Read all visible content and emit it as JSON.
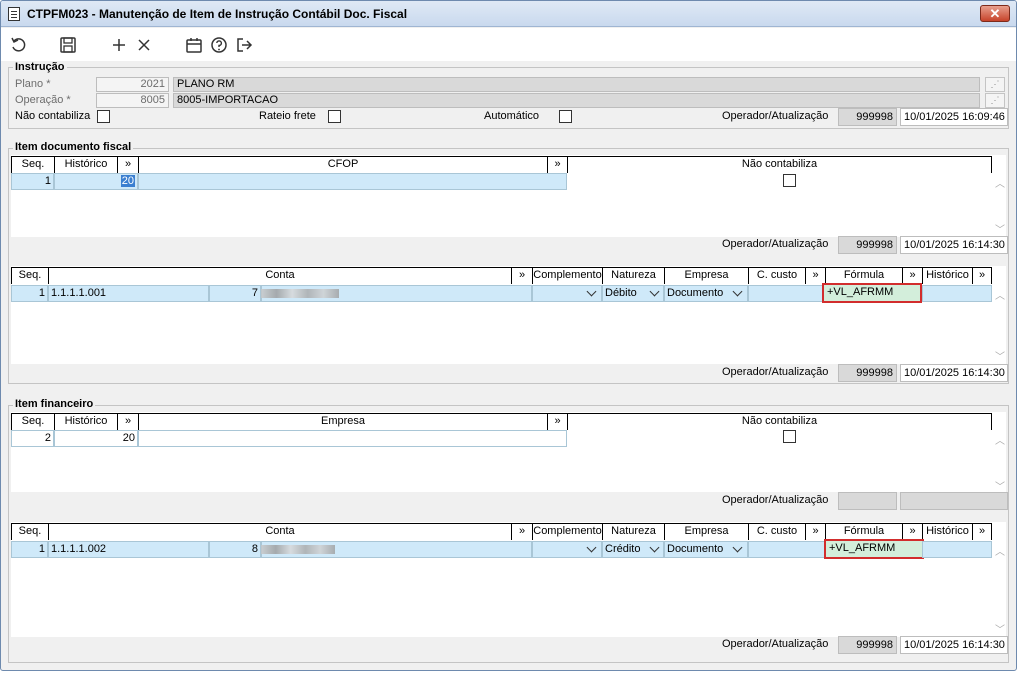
{
  "window": {
    "title": "CTPFM023 - Manutenção de Item de Instrução Contábil Doc. Fiscal",
    "close_label": "✕"
  },
  "toolbar": {
    "icons": [
      "undo-icon",
      "save-icon",
      "add-icon",
      "delete-icon",
      "calendar-icon",
      "help-icon",
      "exit-icon"
    ]
  },
  "instrucao": {
    "title": "Instrução",
    "plano_label": "Plano *",
    "plano_code": "2021",
    "plano_name": "PLANO RM",
    "operacao_label": "Operação *",
    "operacao_code": "8005",
    "operacao_name": "8005-IMPORTACAO",
    "nao_contabiliza_label": "Não contabiliza",
    "rateio_label": "Rateio frete",
    "automatico_label": "Automático",
    "oper_label": "Operador/Atualização",
    "operador": "999998",
    "atualizacao": "10/01/2025 16:09:46"
  },
  "item_doc": {
    "title": "Item documento fiscal",
    "headers": {
      "seq": "Seq.",
      "historico": "Histórico",
      "more": "»",
      "cfop": "CFOP",
      "nao_contabiliza": "Não contabiliza"
    },
    "row": {
      "seq": "1",
      "historico": "20"
    },
    "oper_label": "Operador/Atualização",
    "operador": "999998",
    "atualizacao": "10/01/2025 16:14:30"
  },
  "conta_grid_1": {
    "headers": {
      "seq": "Seq.",
      "conta": "Conta",
      "more": "»",
      "complemento": "Complemento",
      "natureza": "Natureza",
      "empresa": "Empresa",
      "ccusto": "C. custo",
      "formula": "Fórmula",
      "historico": "Histórico"
    },
    "row": {
      "seq": "1",
      "conta": "1.1.1.1.001",
      "conta_num": "7",
      "natureza": "Débito",
      "empresa": "Documento",
      "formula": "+VL_AFRMM"
    },
    "oper_label": "Operador/Atualização",
    "operador": "999998",
    "atualizacao": "10/01/2025 16:14:30"
  },
  "item_fin": {
    "title": "Item financeiro",
    "headers": {
      "seq": "Seq.",
      "historico": "Histórico",
      "more": "»",
      "empresa": "Empresa",
      "nao_contabiliza": "Não contabiliza"
    },
    "row": {
      "seq": "2",
      "historico": "20"
    },
    "oper_label": "Operador/Atualização"
  },
  "conta_grid_2": {
    "headers": {
      "seq": "Seq.",
      "conta": "Conta",
      "more": "»",
      "complemento": "Complemento",
      "natureza": "Natureza",
      "empresa": "Empresa",
      "ccusto": "C. custo",
      "formula": "Fórmula",
      "historico": "Histórico"
    },
    "row": {
      "seq": "1",
      "conta": "1.1.1.1.002",
      "conta_num": "8",
      "natureza": "Crédito",
      "empresa": "Documento",
      "formula": "+VL_AFRMM"
    },
    "oper_label": "Operador/Atualização",
    "operador": "999998",
    "atualizacao": "10/01/2025 16:14:30"
  }
}
